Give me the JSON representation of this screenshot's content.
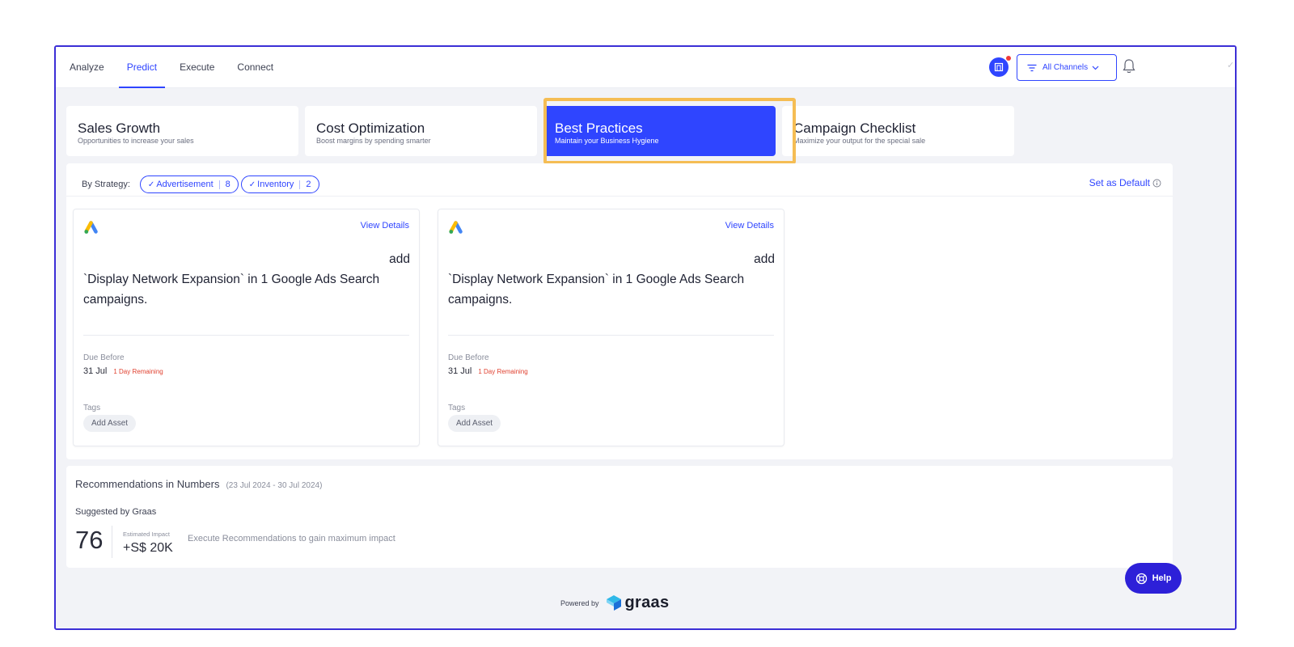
{
  "nav": {
    "items": [
      {
        "label": "Analyze",
        "active": false
      },
      {
        "label": "Predict",
        "active": true
      },
      {
        "label": "Execute",
        "active": false
      },
      {
        "label": "Connect",
        "active": false
      }
    ]
  },
  "header": {
    "channels_label": "All Channels"
  },
  "categories": [
    {
      "title": "Sales Growth",
      "subtitle": "Opportunities to increase your sales",
      "active": false
    },
    {
      "title": "Cost Optimization",
      "subtitle": "Boost margins by spending smarter",
      "active": false
    },
    {
      "title": "Best Practices",
      "subtitle": "Maintain your Business Hygiene",
      "active": true
    },
    {
      "title": "Campaign Checklist",
      "subtitle": "Maximize your output for the special sale",
      "active": false
    }
  ],
  "strategy": {
    "label": "By Strategy:",
    "chips": [
      {
        "label": "Advertisement",
        "count": "8"
      },
      {
        "label": "Inventory",
        "count": "2"
      }
    ],
    "set_default": "Set as Default"
  },
  "recommendations": [
    {
      "view_details": "View Details",
      "text_top": "add",
      "text_main": "`Display Network Expansion` in 1 Google Ads Search campaigns.",
      "due_label": "Due Before",
      "due_date": "31 Jul",
      "due_remaining": "1 Day Remaining",
      "tags_label": "Tags",
      "tag": "Add Asset"
    },
    {
      "view_details": "View Details",
      "text_top": "add",
      "text_main": "`Display Network Expansion` in 1 Google Ads Search campaigns.",
      "due_label": "Due Before",
      "due_date": "31 Jul",
      "due_remaining": "1 Day Remaining",
      "tags_label": "Tags",
      "tag": "Add Asset"
    }
  ],
  "numbers": {
    "title": "Recommendations in Numbers",
    "range": "(23 Jul 2024 - 30 Jul 2024)",
    "suggested_by": "Suggested by Graas",
    "count": "76",
    "impact_label": "Estimated Impact",
    "impact_value": "+S$ 20K",
    "execute_text": "Execute Recommendations to gain maximum impact"
  },
  "footer": {
    "powered_by": "Powered by",
    "brand": "graas"
  },
  "help": {
    "label": "Help"
  },
  "colors": {
    "accent": "#2f45ff",
    "highlight": "#f5bd54",
    "frame": "#3c2fd6",
    "danger": "#e0402f",
    "help_bg": "#2d20d8"
  }
}
